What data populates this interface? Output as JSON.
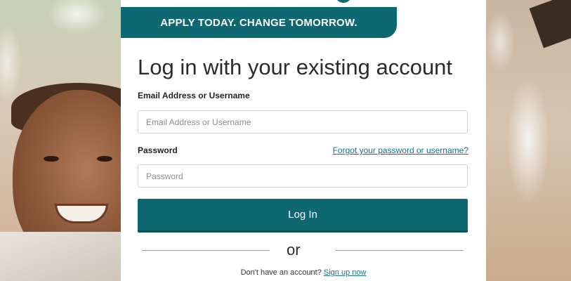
{
  "banner": {
    "text": "APPLY TODAY. CHANGE TOMORROW.",
    "color": "#0e6872"
  },
  "login": {
    "title": "Log in with your existing account",
    "email_label": "Email Address or Username",
    "email_placeholder": "Email Address or Username",
    "email_value": "",
    "password_label": "Password",
    "password_placeholder": "Password",
    "password_value": "",
    "forgot_link": "Forgot your password or username?",
    "submit_label": "Log In",
    "divider_text": "or",
    "signup_prompt": "Don't have an account?",
    "signup_link": "Sign up now"
  },
  "colors": {
    "accent": "#0e6872",
    "link": "#1a6f8a"
  }
}
